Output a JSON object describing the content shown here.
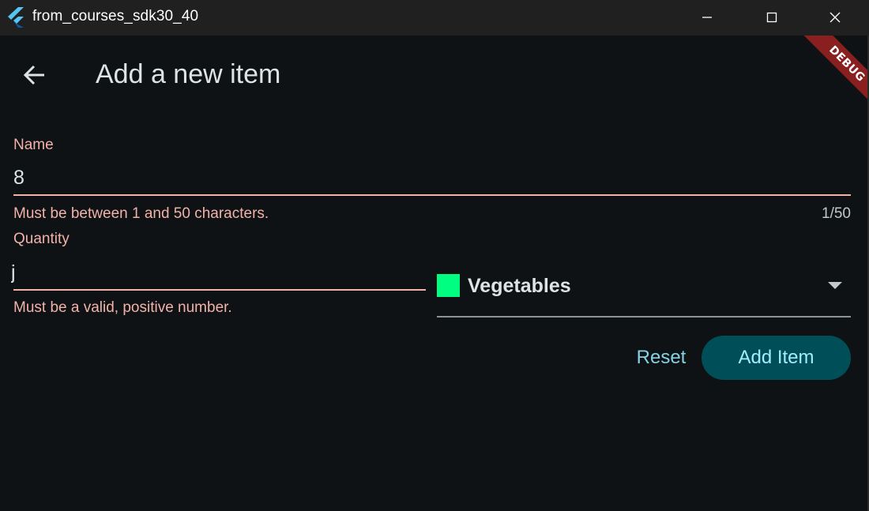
{
  "window": {
    "title": "from_courses_sdk30_40"
  },
  "appbar": {
    "title": "Add a new item",
    "debug_banner": "DEBUG"
  },
  "form": {
    "name": {
      "label": "Name",
      "value": "8",
      "error": "Must be between 1 and 50 characters.",
      "counter": "1/50"
    },
    "quantity": {
      "label": "Quantity",
      "value": "j",
      "error": "Must be a valid, positive number."
    },
    "category": {
      "selected": "Vegetables",
      "swatch_color": "#00ff80"
    },
    "reset_label": "Reset",
    "submit_label": "Add Item"
  },
  "colors": {
    "background": "#0e1215",
    "error": "#f2b2a8",
    "primary_button": "#004f58",
    "accent_text": "#84d2e2"
  },
  "icons": {
    "app": "flutter-icon",
    "back": "arrow-back-icon",
    "minimize": "minimize-icon",
    "maximize": "maximize-icon",
    "close": "close-icon",
    "dropdown": "caret-down-icon"
  }
}
